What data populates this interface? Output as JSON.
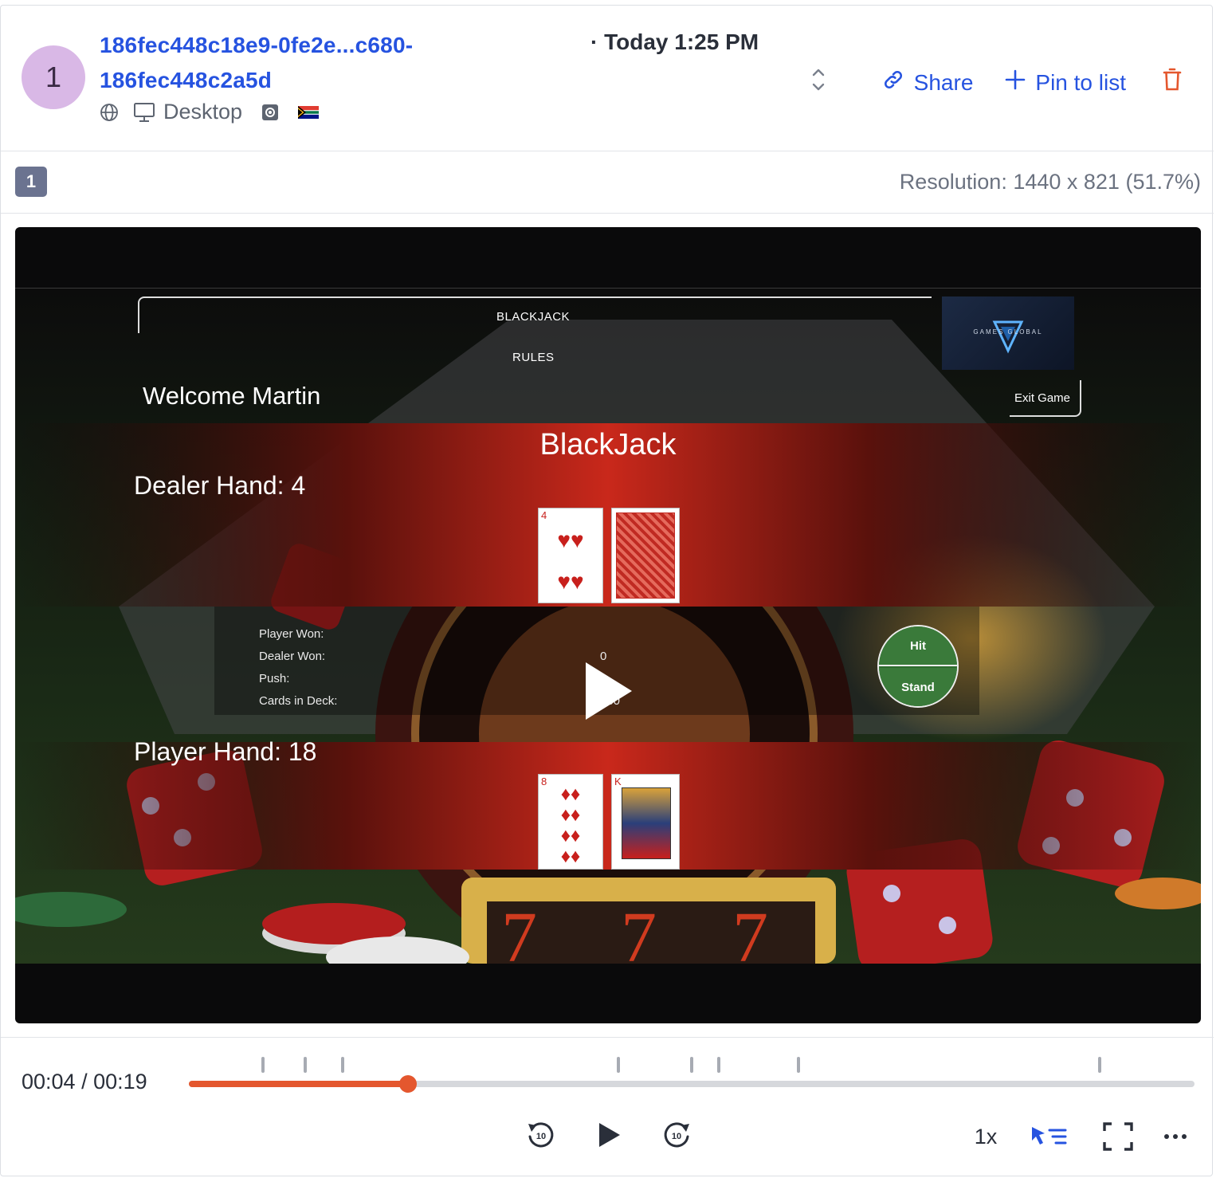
{
  "session": {
    "avatar_number": "1",
    "id_line1": "186fec448c18e9-0fe2e...c680-",
    "id_line2": "186fec448c2a5d",
    "time": "· Today 1:25 PM",
    "device": "Desktop",
    "globe_icon": "globe-icon",
    "device_icon": "monitor-icon",
    "os_icon": "os-icon",
    "country_flag": "south-africa-flag"
  },
  "actions": {
    "share_label": "Share",
    "pin_label": "Pin to list",
    "expand_icon": "chevron-up-down-icon",
    "delete_icon": "trash-icon"
  },
  "page": {
    "badge": "1",
    "resolution": "Resolution: 1440 x 821 (51.7%)"
  },
  "game": {
    "nav_blackjack": "BLACKJACK",
    "nav_rules": "RULES",
    "welcome": "Welcome Martin",
    "logo_text": "GAMES GLOBAL",
    "exit": "Exit Game",
    "title": "BlackJack",
    "dealer_hand": "Dealer Hand: 4",
    "player_hand": "Player Hand: 18",
    "stats": [
      {
        "label": "Player Won:",
        "value": ""
      },
      {
        "label": "Dealer Won:",
        "value": "0"
      },
      {
        "label": "Push:",
        "value": "0"
      },
      {
        "label": "Cards in Deck:",
        "value": "360"
      }
    ],
    "hit": "Hit",
    "stand": "Stand",
    "dealer_cards": [
      {
        "rank": "4",
        "suit": "♥"
      },
      {
        "rank": "",
        "suit": "back"
      }
    ],
    "player_cards": [
      {
        "rank": "8",
        "suit": "♦"
      },
      {
        "rank": "K",
        "suit": "♦"
      }
    ]
  },
  "player": {
    "timecode": "00:04 / 00:19",
    "progress": 0.218,
    "event_markers": [
      0.074,
      0.116,
      0.153,
      0.427,
      0.5,
      0.527,
      0.606,
      0.906
    ],
    "speed": "1x",
    "colors": {
      "progress": "#e4572e",
      "accent": "#2653e0"
    }
  }
}
